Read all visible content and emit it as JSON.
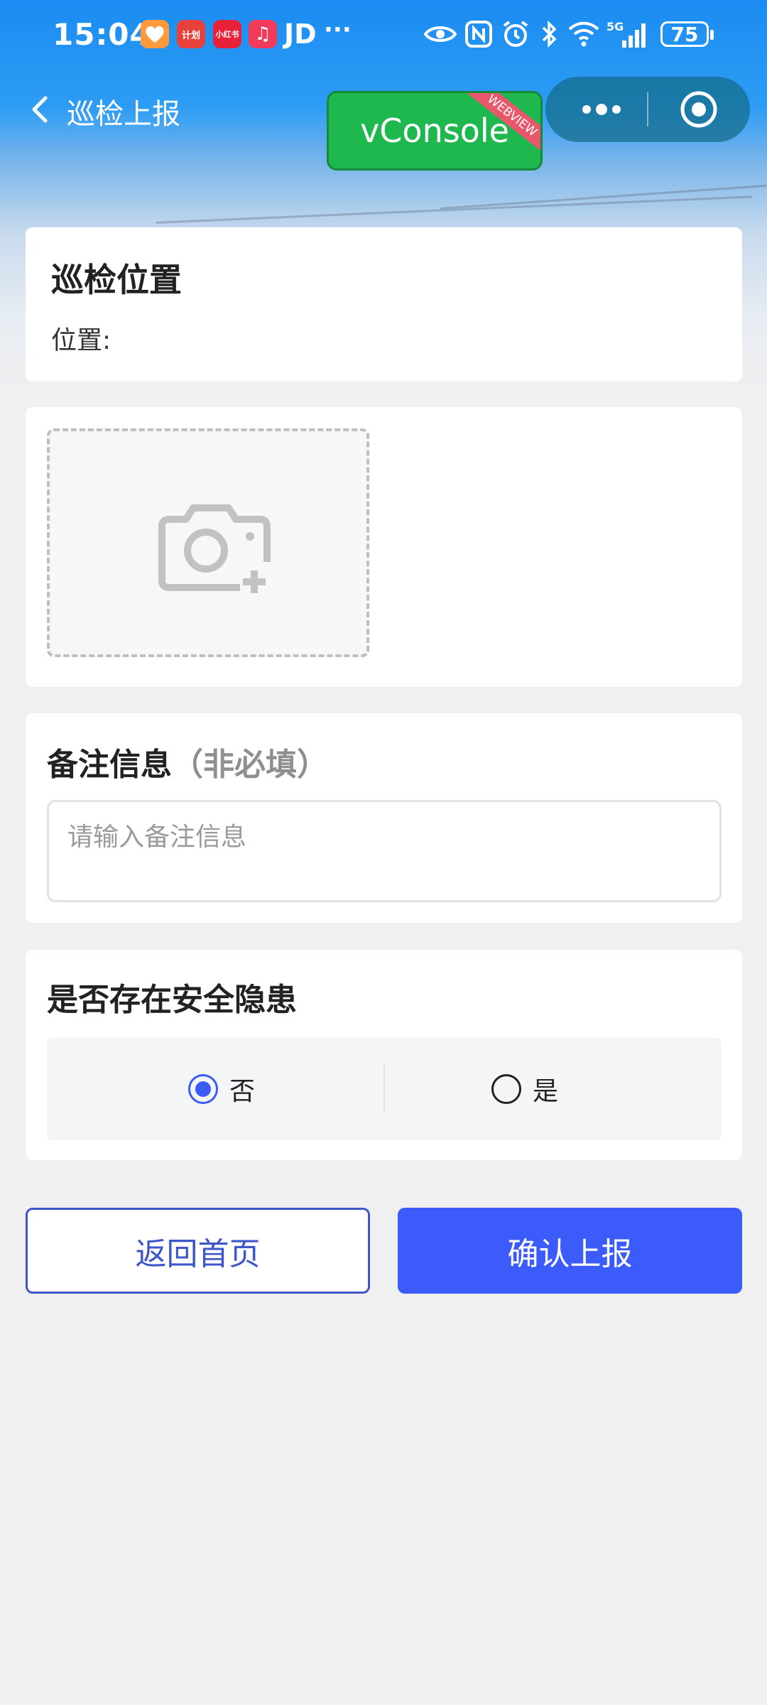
{
  "status_bar": {
    "time": "15:04",
    "app_icons": [
      {
        "name": "heart-app-icon",
        "color": "#ff9a3c",
        "text": ""
      },
      {
        "name": "news-app-icon",
        "color": "#e8403a",
        "text": "计划"
      },
      {
        "name": "xiaohongshu-icon",
        "color": "#e8213a",
        "text": "小红书"
      },
      {
        "name": "music-app-icon",
        "color": "#f23a5a",
        "text": "♫"
      }
    ],
    "jd_label": "JD",
    "more_dots": "···",
    "battery_level": "75"
  },
  "nav": {
    "title": "巡检上报",
    "vconsole_label": "vConsole",
    "webview_ribbon": "WEBVIEW"
  },
  "location_card": {
    "title": "巡检位置",
    "label": "位置:"
  },
  "remark_card": {
    "title": "备注信息",
    "hint": "（非必填）",
    "placeholder": "请输入备注信息"
  },
  "hazard_card": {
    "title": "是否存在安全隐患",
    "options": [
      {
        "label": "否",
        "selected": true
      },
      {
        "label": "是",
        "selected": false
      }
    ]
  },
  "buttons": {
    "home_label": "返回首页",
    "submit_label": "确认上报"
  },
  "colors": {
    "primary": "#3b5bfa",
    "header_blue": "#1b8cf2",
    "vconsole_green": "#1fb84f",
    "page_bg": "#f0f0f0"
  }
}
